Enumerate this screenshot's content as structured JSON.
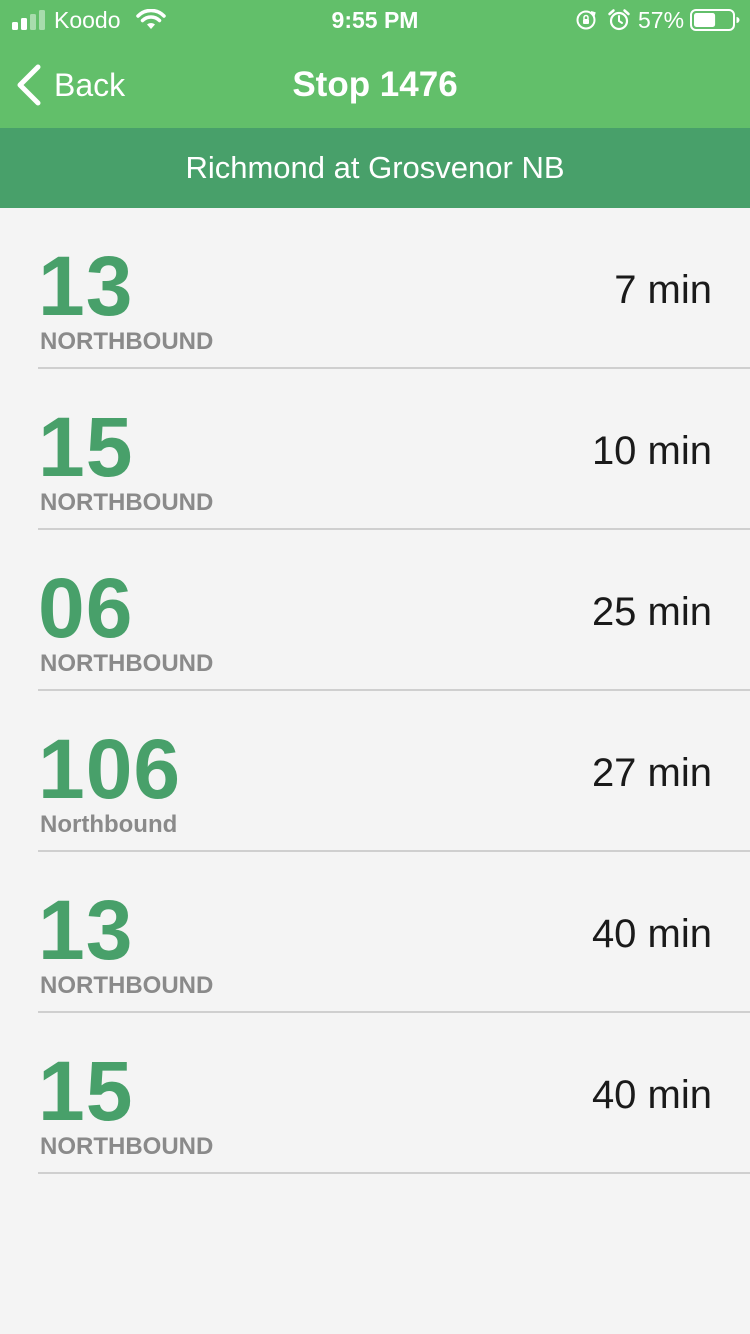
{
  "status_bar": {
    "carrier": "Koodo",
    "time": "9:55 PM",
    "battery_percent": "57%",
    "battery_level": 0.57
  },
  "nav": {
    "back_label": "Back",
    "title": "Stop 1476"
  },
  "stop": {
    "name": "Richmond at Grosvenor NB"
  },
  "colors": {
    "header_green": "#62bf6a",
    "banner_green": "#48a06a",
    "route_green": "#48a06a",
    "direction_gray": "#8a8a8a",
    "background": "#f4f4f4"
  },
  "arrivals": [
    {
      "route": "13",
      "direction": "NORTHBOUND",
      "time": "7 min"
    },
    {
      "route": "15",
      "direction": "NORTHBOUND",
      "time": "10 min"
    },
    {
      "route": "06",
      "direction": "NORTHBOUND",
      "time": "25 min"
    },
    {
      "route": "106",
      "direction": "Northbound",
      "time": "27 min"
    },
    {
      "route": "13",
      "direction": "NORTHBOUND",
      "time": "40 min"
    },
    {
      "route": "15",
      "direction": "NORTHBOUND",
      "time": "40 min"
    }
  ]
}
